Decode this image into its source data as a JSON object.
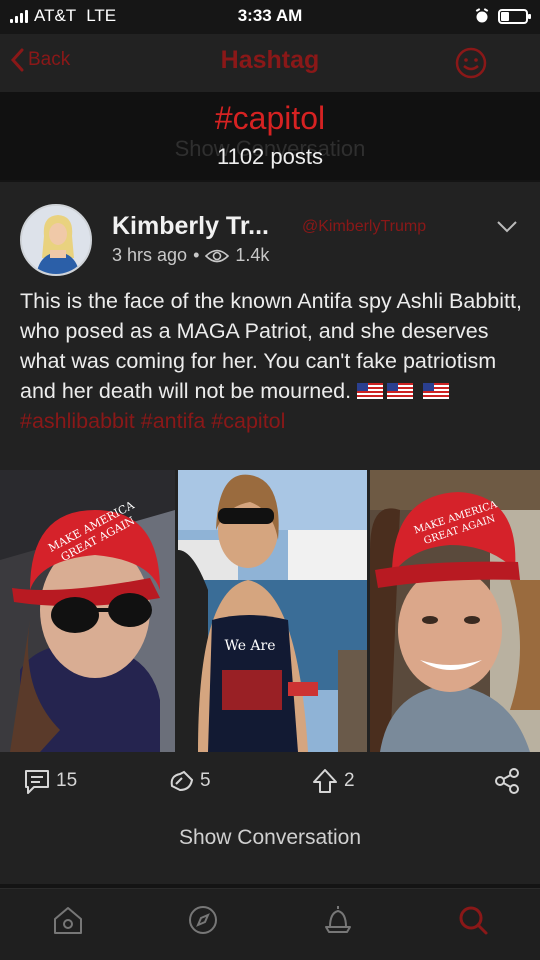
{
  "status_bar": {
    "carrier": "AT&T",
    "network": "LTE",
    "time": "3:33 AM",
    "battery_fraction": 0.35
  },
  "nav": {
    "back_label": "Back",
    "title": "Hashtag",
    "action_icon": "smiley-icon"
  },
  "header": {
    "hashtag": "#capitol",
    "post_count": "1102 posts",
    "underlay_text": "Show Conversation"
  },
  "post": {
    "author_name": "Kimberly Tr...",
    "author_handle": "@KimberlyTrump",
    "time_ago": "3 hrs ago",
    "separator": "•",
    "views": "1.4k",
    "body": "This is the face of the known Antifa spy Ashli Babbitt, who posed as a MAGA Patriot, and she deserves what was coming for her. You can't fake patriotism and her death will not be mourned.",
    "hashtags": [
      "#ashlibabbit",
      "#antifa",
      "#capitol"
    ],
    "photo_captions": {
      "hat_line1": "MAKE AMERICA",
      "hat_line2": "GREAT AGAIN",
      "shirt_text": "We Are"
    },
    "actions": {
      "comments": "15",
      "reposts": "5",
      "upvotes": "2"
    },
    "show_conversation": "Show Conversation"
  },
  "tab_bar": {
    "items": [
      "home-icon",
      "explore-icon",
      "notifications-icon",
      "search-icon"
    ],
    "active": "search-icon"
  },
  "colors": {
    "accent_red": "#d62222",
    "dim_red": "#8a1818",
    "background": "#141414",
    "card": "#222222"
  }
}
